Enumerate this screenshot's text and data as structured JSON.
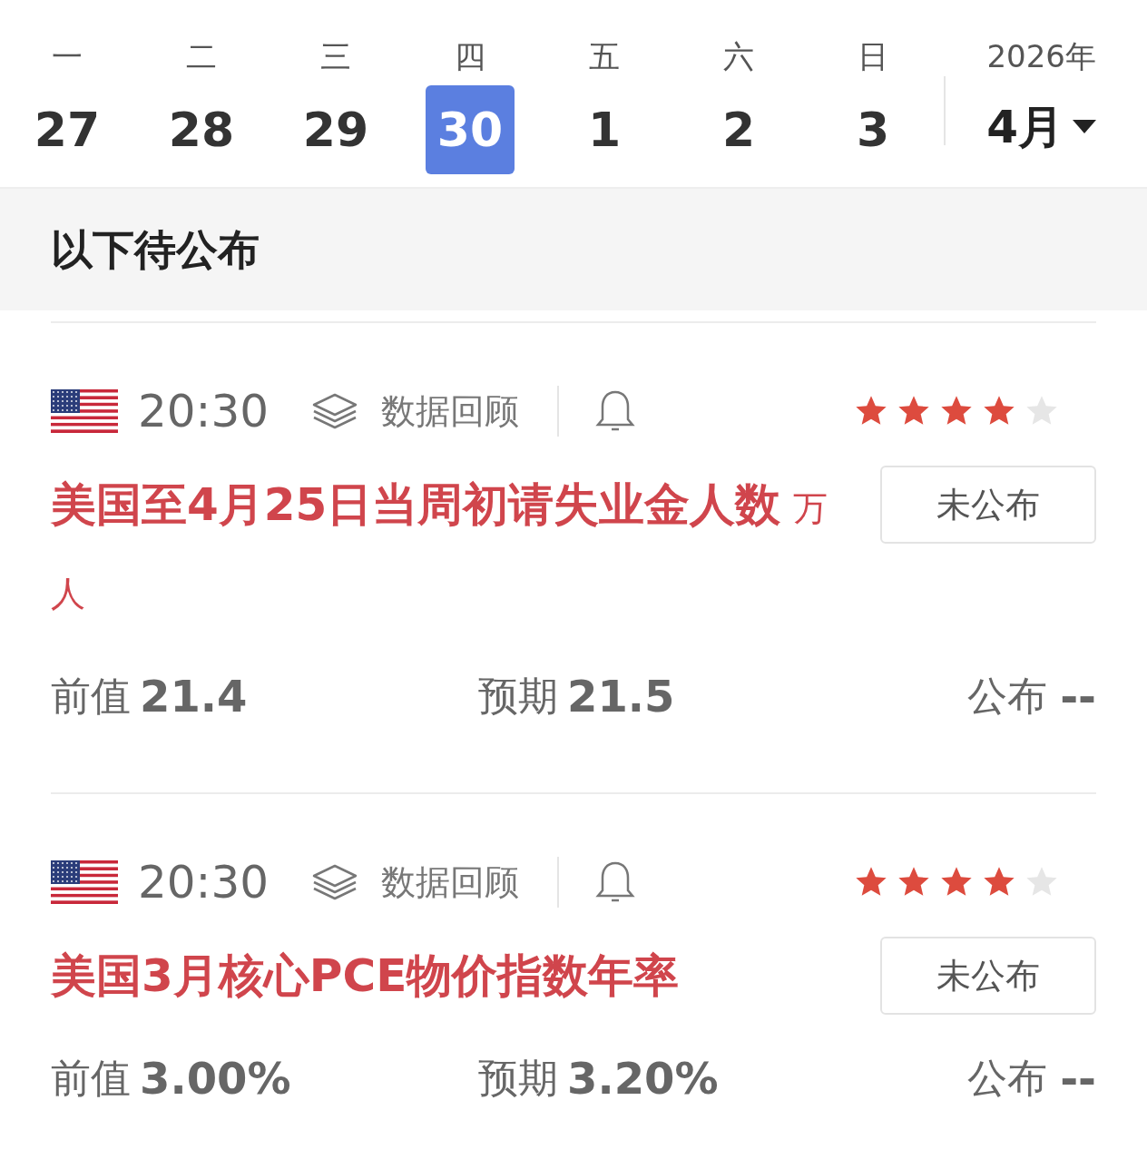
{
  "calendar": {
    "days": [
      {
        "weekday": "一",
        "date": "27",
        "selected": false
      },
      {
        "weekday": "二",
        "date": "28",
        "selected": false
      },
      {
        "weekday": "三",
        "date": "29",
        "selected": false
      },
      {
        "weekday": "四",
        "date": "30",
        "selected": true
      },
      {
        "weekday": "五",
        "date": "1",
        "selected": false
      },
      {
        "weekday": "六",
        "date": "2",
        "selected": false
      },
      {
        "weekday": "日",
        "date": "3",
        "selected": false
      }
    ],
    "year": "2026年",
    "month": "4月"
  },
  "section_title": "以下待公布",
  "events": [
    {
      "time": "20:30",
      "review_label": "数据回顾",
      "stars": 4,
      "title": "美国至4月25日当周初请失业金人数",
      "unit": "万人",
      "status": "未公布",
      "previous_label": "前值",
      "previous": "21.4",
      "forecast_label": "预期",
      "forecast": "21.5",
      "actual_label": "公布",
      "actual": "--"
    },
    {
      "time": "20:30",
      "review_label": "数据回顾",
      "stars": 4,
      "title": "美国3月核心PCE物价指数年率",
      "status": "未公布",
      "previous_label": "前值",
      "previous": "3.00%",
      "forecast_label": "预期",
      "forecast": "3.20%",
      "actual_label": "公布",
      "actual": "--"
    }
  ]
}
